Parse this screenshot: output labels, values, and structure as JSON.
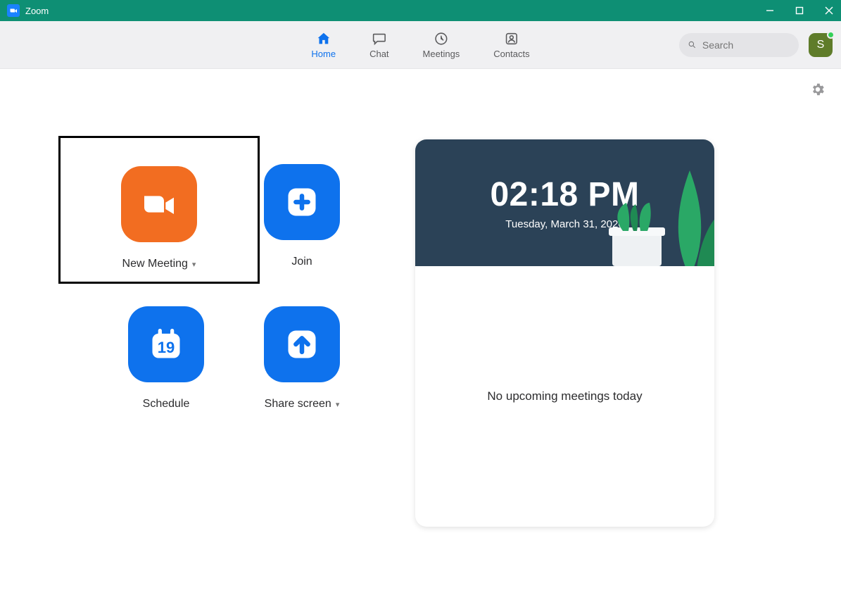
{
  "window": {
    "title": "Zoom"
  },
  "tabs": [
    {
      "label": "Home"
    },
    {
      "label": "Chat"
    },
    {
      "label": "Meetings"
    },
    {
      "label": "Contacts"
    }
  ],
  "search": {
    "placeholder": "Search"
  },
  "avatar": {
    "initial": "S"
  },
  "actions": {
    "new_meeting": "New Meeting",
    "join": "Join",
    "schedule": "Schedule",
    "share_screen": "Share screen",
    "schedule_day": "19"
  },
  "info": {
    "time": "02:18 PM",
    "date": "Tuesday, March 31, 2020",
    "empty_message": "No upcoming meetings today"
  }
}
